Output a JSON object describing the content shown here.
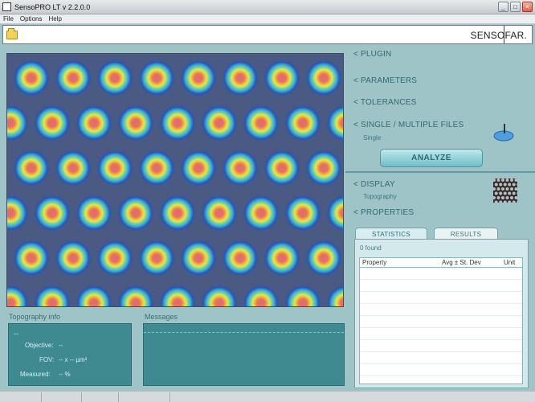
{
  "window": {
    "title": "SensoPRO LT v 2.2.0.0",
    "brand": "SENSOFAR."
  },
  "menu": [
    "File",
    "Options",
    "Help"
  ],
  "right_panel": {
    "plugin": "< PLUGIN",
    "parameters": "< PARAMETERS",
    "tolerances": "< TOLERANCES",
    "files": "< SINGLE / MULTIPLE FILES",
    "files_mode": "Single",
    "analyze": "ANALYZE",
    "display": "< DISPLAY",
    "display_mode": "Topography",
    "properties": "< PROPERTIES"
  },
  "tabs": {
    "statistics": "STATISTICS",
    "results": "RESULTS"
  },
  "results": {
    "found": "0 found",
    "headers": {
      "property": "Property",
      "avg": "Avg ± St. Dev",
      "unit": "Unit"
    }
  },
  "topography_info": {
    "label": "Topography info",
    "dashes": "--",
    "objective_label": "Objective:",
    "objective_value": "--",
    "fov_label": "FOV:",
    "fov_value": "-- x -- µm²",
    "measured_label": "Measured:",
    "measured_value": "-- %"
  },
  "messages": {
    "label": "Messages"
  },
  "colors": {
    "background": "#9fc4c8",
    "image_background": "#4a5a82",
    "heat_center": "#e06a6e",
    "info_panel": "#3f8a91",
    "accent": "#2f6a72"
  }
}
